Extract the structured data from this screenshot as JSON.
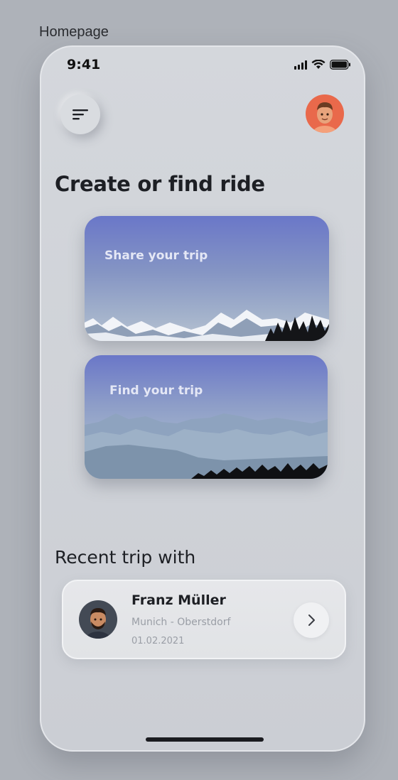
{
  "frame": {
    "label": "Homepage"
  },
  "status_bar": {
    "time": "9:41",
    "icons": [
      "signal-icon",
      "wifi-icon",
      "battery-icon"
    ]
  },
  "header": {
    "menu_icon": "menu-icon",
    "avatar_icon": "user-avatar"
  },
  "main": {
    "title": "Create or find ride",
    "cards": [
      {
        "label": "Share your trip"
      },
      {
        "label": "Find your trip"
      }
    ]
  },
  "recent": {
    "title": "Recent trip with",
    "trip": {
      "name": "Franz Müller",
      "route": "Munich - Oberstdorf",
      "date": "01.02.2021",
      "action_icon": "chevron-right-icon"
    }
  },
  "colors": {
    "background": "#aeb2b9",
    "phone": "#d1d4d9",
    "accent_avatar": "#e9694b",
    "card_sky": "#6a77c8",
    "text_primary": "#1d1f24",
    "text_secondary": "#9a9ea6"
  }
}
